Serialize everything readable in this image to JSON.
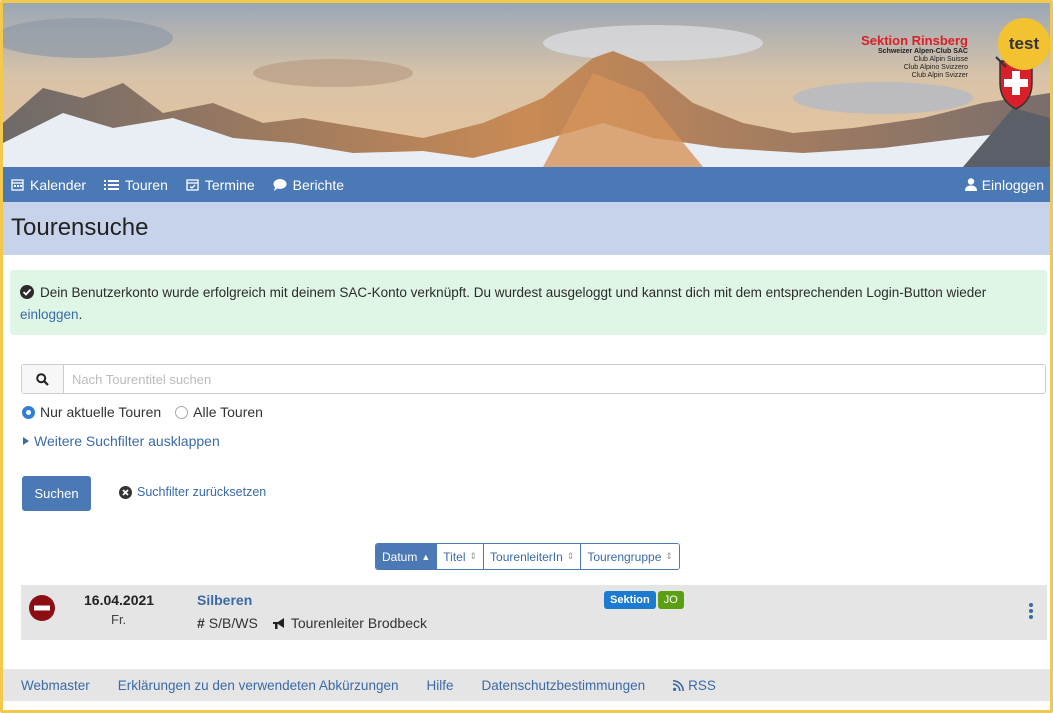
{
  "banner": {
    "section_name": "Sektion Rinsberg",
    "club_lines": [
      "Schweizer Alpen-Club SAC",
      "Club Alpin Suisse",
      "Club Alpino Svizzero",
      "Club Alpin Svizzer"
    ],
    "env_badge": "test"
  },
  "nav": {
    "items": [
      {
        "label": "Kalender",
        "icon": "calendar-icon"
      },
      {
        "label": "Touren",
        "icon": "list-icon"
      },
      {
        "label": "Termine",
        "icon": "calendar-check-icon"
      },
      {
        "label": "Berichte",
        "icon": "comment-icon"
      }
    ],
    "login": "Einloggen"
  },
  "page": {
    "title": "Tourensuche"
  },
  "alert": {
    "message": "Dein Benutzerkonto wurde erfolgreich mit deinem SAC-Konto verknüpft. Du wurdest ausgeloggt und kannst dich mit dem entsprechenden Login-Button wieder",
    "link": "einloggen",
    "suffix": "."
  },
  "search": {
    "placeholder": "Nach Tourentitel suchen",
    "radio_current": "Nur aktuelle Touren",
    "radio_all": "Alle Touren",
    "selected": "current",
    "more_filters": "Weitere Suchfilter ausklappen",
    "submit": "Suchen",
    "reset": "Suchfilter zurücksetzen"
  },
  "sort": {
    "options": [
      {
        "label": "Datum",
        "active": true
      },
      {
        "label": "Titel",
        "active": false
      },
      {
        "label": "TourenleiterIn",
        "active": false
      },
      {
        "label": "Tourengruppe",
        "active": false
      }
    ]
  },
  "tours": [
    {
      "date": "16.04.2021",
      "weekday": "Fr.",
      "title": "Silberen",
      "difficulty": "S/B/WS",
      "leader": "Tourenleiter Brodbeck",
      "badges": [
        "Sektion",
        "JO"
      ],
      "status": "cancelled"
    }
  ],
  "footer": {
    "links": [
      "Webmaster",
      "Erklärungen zu den verwendeten Abkürzungen",
      "Hilfe",
      "Datenschutzbestimmungen"
    ],
    "rss": "RSS"
  },
  "colors": {
    "nav": "#4a79b5",
    "title_bg": "#c7d3ea",
    "alert_bg": "#dff5e6",
    "link": "#3a6aa8",
    "badge_sektion": "#1c7bd1",
    "badge_jo": "#5ba012",
    "env_badge": "#f2c230",
    "status_cancelled": "#8b0e12"
  }
}
